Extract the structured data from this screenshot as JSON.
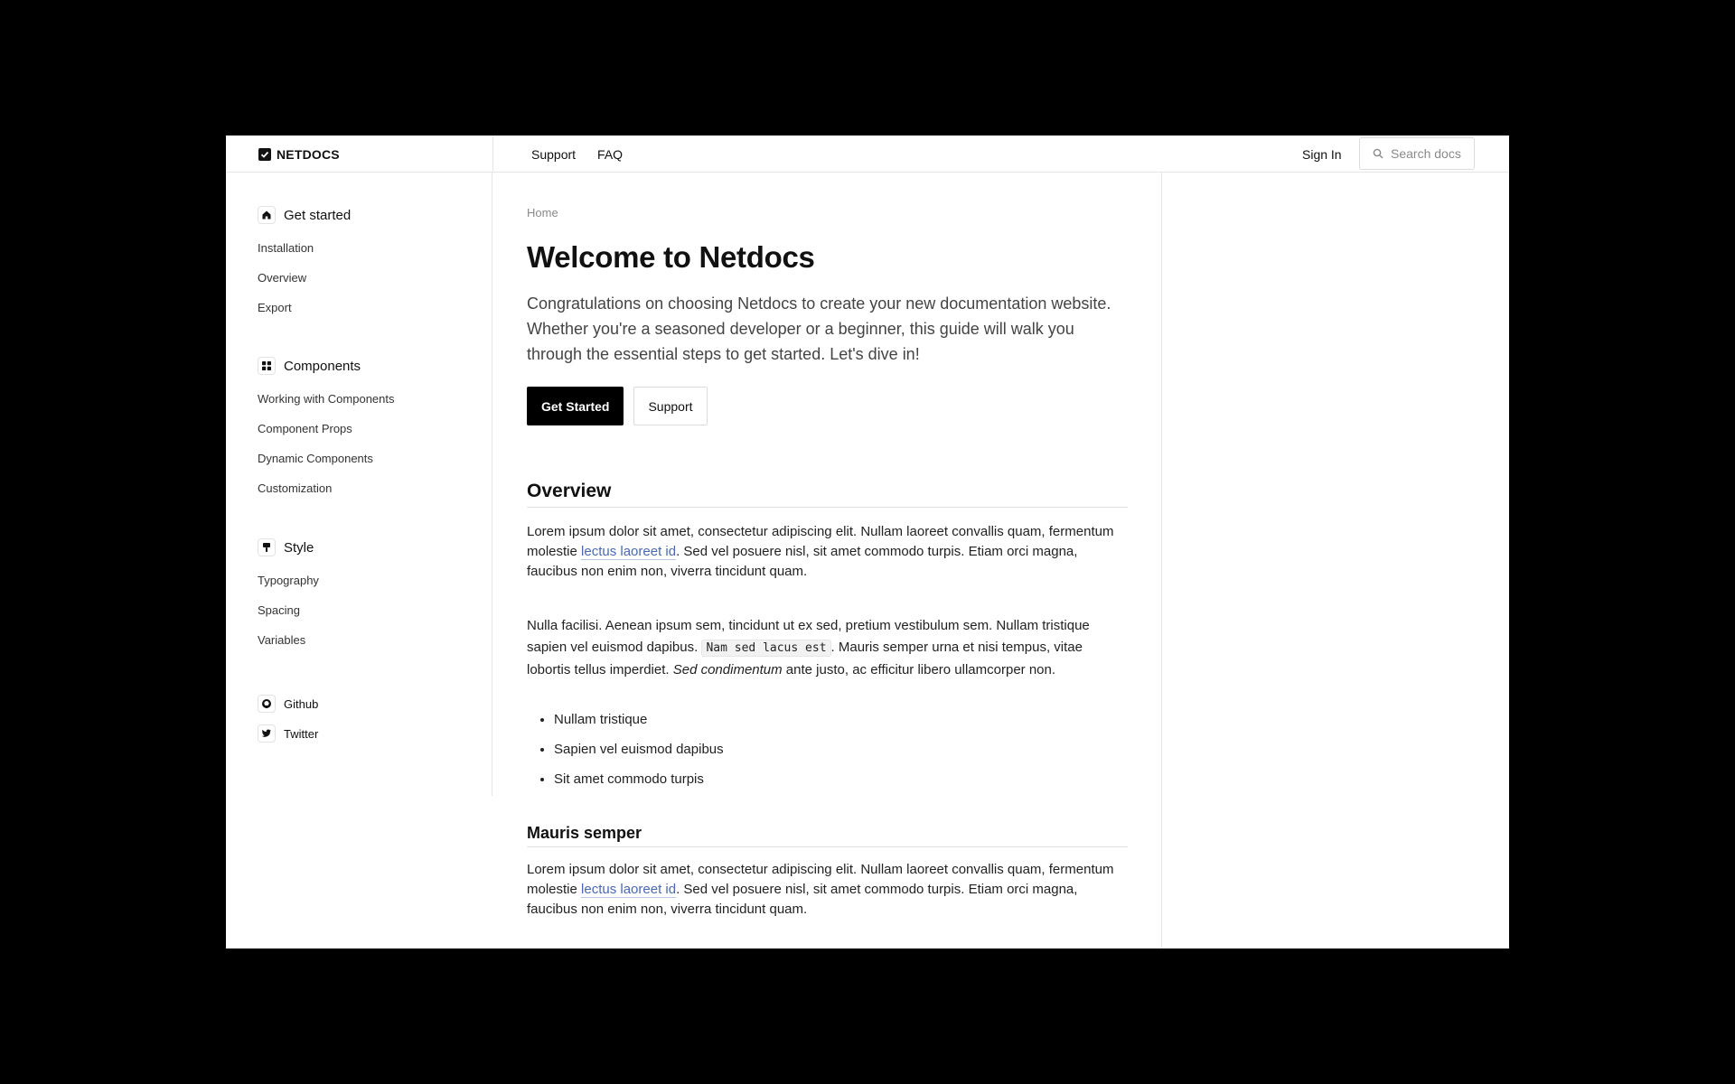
{
  "header": {
    "brand": "NETDOCS",
    "nav": [
      "Support",
      "FAQ"
    ],
    "sign_in": "Sign In",
    "search_placeholder": "Search docs"
  },
  "sidebar": {
    "sections": [
      {
        "title": "Get started",
        "icon": "home-icon",
        "items": [
          "Installation",
          "Overview",
          "Export"
        ]
      },
      {
        "title": "Components",
        "icon": "grid-icon",
        "items": [
          "Working with Components",
          "Component Props",
          "Dynamic Components",
          "Customization"
        ]
      },
      {
        "title": "Style",
        "icon": "paintbrush-icon",
        "items": [
          "Typography",
          "Spacing",
          "Variables"
        ]
      }
    ],
    "social": [
      {
        "label": "Github",
        "icon": "github-icon"
      },
      {
        "label": "Twitter",
        "icon": "twitter-icon"
      }
    ]
  },
  "main": {
    "breadcrumb": "Home",
    "title": "Welcome to Netdocs",
    "lead": "Congratulations on choosing Netdocs to create your new documentation website. Whether you're a seasoned developer or a beginner, this guide will walk you through the essential steps to get started. Let's dive in!",
    "buttons": {
      "primary": "Get Started",
      "secondary": "Support"
    },
    "overview": {
      "heading": "Overview",
      "p1_before": "Lorem ipsum dolor sit amet, consectetur adipiscing elit. Nullam laoreet convallis quam, fermentum molestie ",
      "p1_link": "lectus laoreet id",
      "p1_after": ". Sed vel posuere nisl, sit amet commodo turpis. Etiam orci magna, faucibus non enim non, viverra tincidunt quam.",
      "p2_before": "Nulla facilisi. Aenean ipsum sem, tincidunt ut ex sed, pretium vestibulum sem. Nullam tristique sapien vel euismod dapibus. ",
      "p2_code": "Nam sed lacus est",
      "p2_middle": ". Mauris semper urna et nisi tempus, vitae lobortis tellus imperdiet. ",
      "p2_em": "Sed condimentum",
      "p2_after": " ante justo, ac efficitur libero ullamcorper non.",
      "bullets": [
        "Nullam tristique",
        "Sapien vel euismod dapibus",
        "Sit amet commodo turpis"
      ]
    },
    "mauris": {
      "heading": "Mauris semper",
      "p_before": "Lorem ipsum dolor sit amet, consectetur adipiscing elit. Nullam laoreet convallis quam, fermentum molestie ",
      "p_link": "lectus laoreet id",
      "p_after": ". Sed vel posuere nisl, sit amet commodo turpis. Etiam orci magna, faucibus non enim non, viverra tincidunt quam."
    }
  }
}
